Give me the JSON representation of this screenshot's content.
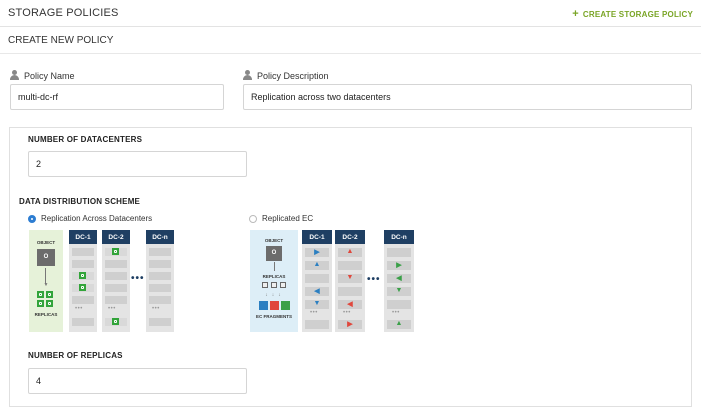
{
  "header": {
    "title": "STORAGE POLICIES",
    "action_label": "CREATE STORAGE POLICY",
    "action_icon": "plus-icon",
    "accent_color": "#7aa526"
  },
  "subheader": {
    "title": "CREATE NEW POLICY"
  },
  "form": {
    "policy_name": {
      "label": "Policy Name",
      "value": "multi-dc-rf",
      "icon": "user-icon"
    },
    "policy_description": {
      "label": "Policy Description",
      "value": "Replication across two datacenters",
      "icon": "user-icon"
    }
  },
  "datacenters": {
    "label": "NUMBER OF DATACENTERS",
    "value": "2"
  },
  "scheme": {
    "label": "DATA DISTRIBUTION SCHEME",
    "selected": "replication",
    "options": [
      {
        "id": "replication",
        "label": "Replication Across Datacenters",
        "checked": true
      },
      {
        "id": "ec",
        "label": "Replicated EC",
        "checked": false
      }
    ],
    "replication_diagram": {
      "object_label": "OBJECT",
      "object_glyph": "O",
      "replicas_label": "REPLICAS",
      "columns": [
        "DC-1",
        "DC-2",
        "DC-n"
      ]
    },
    "ec_diagram": {
      "object_label": "OBJECT",
      "object_glyph": "O",
      "replicas_label": "REPLICAS",
      "fragments_label": "EC FRAGMENTS",
      "columns": [
        "DC-1",
        "DC-2",
        "DC-n"
      ]
    }
  },
  "replicas": {
    "label": "NUMBER OF REPLICAS",
    "value": "4"
  },
  "colors": {
    "dc_header": "#1f3f63",
    "replica_green": "#32a43a",
    "radio_selected": "#2d7dd2",
    "ec_blue": "#2b7fc1",
    "ec_red": "#e0473c",
    "ec_green": "#3aa048"
  }
}
